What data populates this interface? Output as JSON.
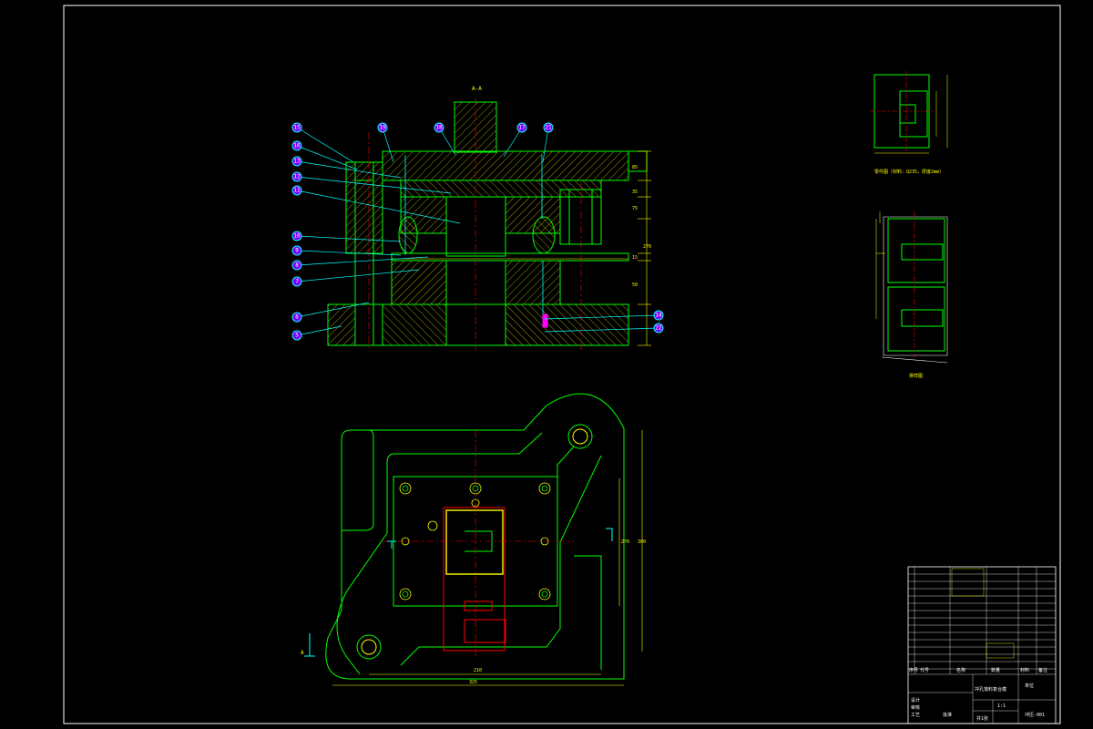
{
  "drawing": {
    "section_label": "A-A",
    "side_label": "A",
    "part_drawing_caption": "零件图（材料：Q235，厚度2mm）",
    "strip_layout_caption": "排样图",
    "dims_plan": [
      "210",
      "325",
      "270",
      "300"
    ],
    "dims_section": [
      "85",
      "35",
      "75",
      "50",
      "15",
      "270"
    ]
  },
  "balloons": {
    "left": [
      "15",
      "16",
      "13",
      "12",
      "11",
      "10",
      "9",
      "8",
      "7",
      "6",
      "5",
      "4",
      "3",
      "2",
      "1"
    ],
    "top": [
      "19",
      "18",
      "17",
      "21",
      "20"
    ],
    "right": [
      "14",
      "22"
    ]
  },
  "title_block": {
    "drawing_no": "冲压-001",
    "drawing_name": "冲孔落料复合模",
    "scale": "1:1",
    "sheet": "共1张",
    "designer": "设计",
    "checker": "审核",
    "process": "工艺",
    "approve": "批准",
    "unit": "单位",
    "col_headers": [
      "序号",
      "代号",
      "名称",
      "数量",
      "材料",
      "备注"
    ]
  },
  "colors": {
    "frame": "#ffffff",
    "part": "#00ff00",
    "hatch": "#ffff00",
    "center": "#ff0000",
    "leader": "#00ffff",
    "balloon_fill": "#8000ff"
  }
}
